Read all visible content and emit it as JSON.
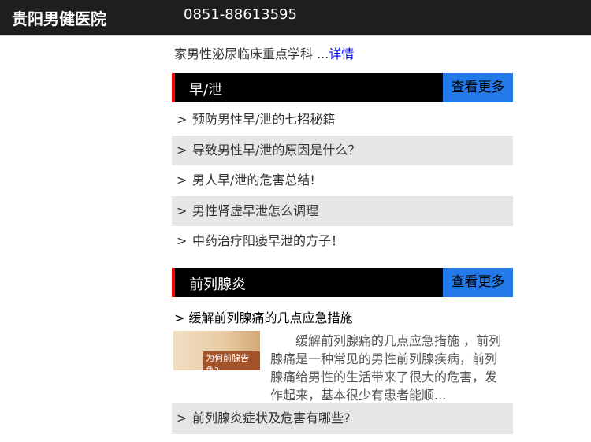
{
  "header": {
    "title": "贵阳男健医院",
    "phone": "0851-88613595"
  },
  "intro": {
    "text": "家男性泌尿临床重点学科 ...",
    "link": "详情"
  },
  "sections": [
    {
      "title": "早/泄",
      "more": "查看更多",
      "items": [
        "预防男性早/泄的七招秘籍",
        "导致男性早/泄的原因是什么？",
        "男人早/泄的危害总结!",
        "男性肾虚早泄怎么调理",
        "中药治疗阳痿早泄的方子！"
      ]
    },
    {
      "title": "前列腺炎",
      "more": "查看更多",
      "featured": {
        "title": "> 缓解前列腺痛的几点应急措施",
        "image_text": "为何前腺告急?",
        "desc": "缓解前列腺痛的几点应急措施 ，前列腺痛是一种常见的男性前列腺疾病，前列腺痛给男性的生活带来了很大的危害，发作起来，基本很少有患者能顺..."
      },
      "items": [
        "前列腺炎症状及危害有哪些?"
      ]
    }
  ],
  "chevron": ">"
}
